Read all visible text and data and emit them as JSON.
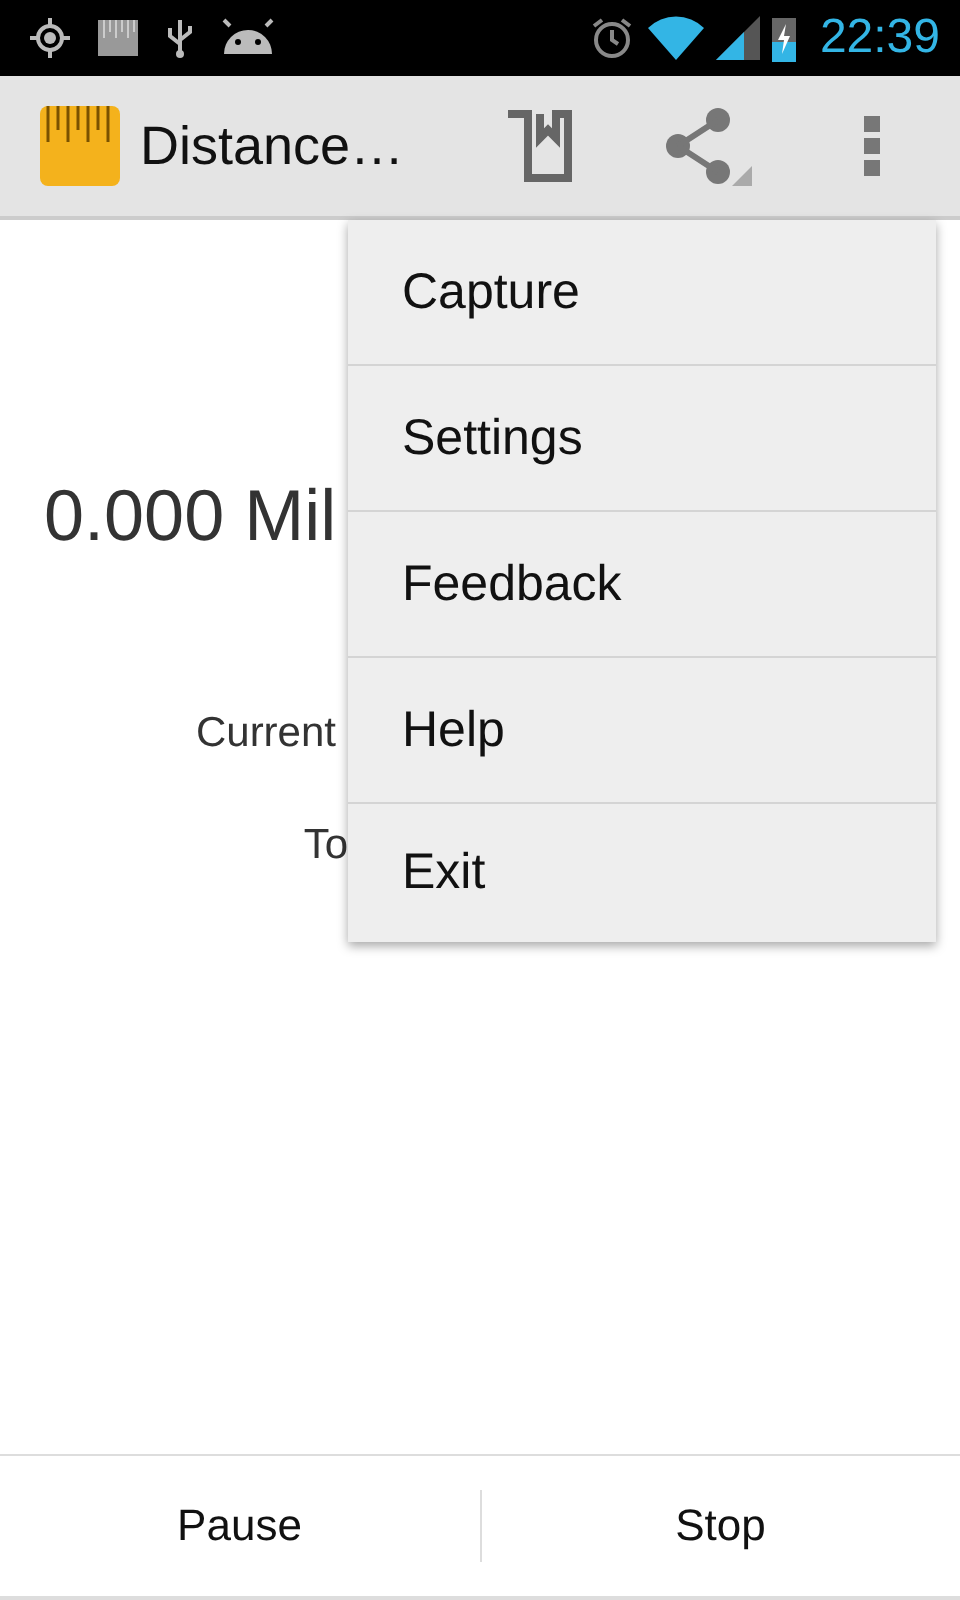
{
  "status_bar": {
    "time": "22:39"
  },
  "action_bar": {
    "title": "Distance…"
  },
  "content": {
    "distance": "0.000 Mil",
    "current_label": "Current",
    "total_label": "To"
  },
  "menu": [
    {
      "label": "Capture"
    },
    {
      "label": "Settings"
    },
    {
      "label": "Feedback"
    },
    {
      "label": "Help"
    },
    {
      "label": "Exit"
    }
  ],
  "buttons": [
    {
      "label": "Pause"
    },
    {
      "label": "Stop"
    }
  ]
}
